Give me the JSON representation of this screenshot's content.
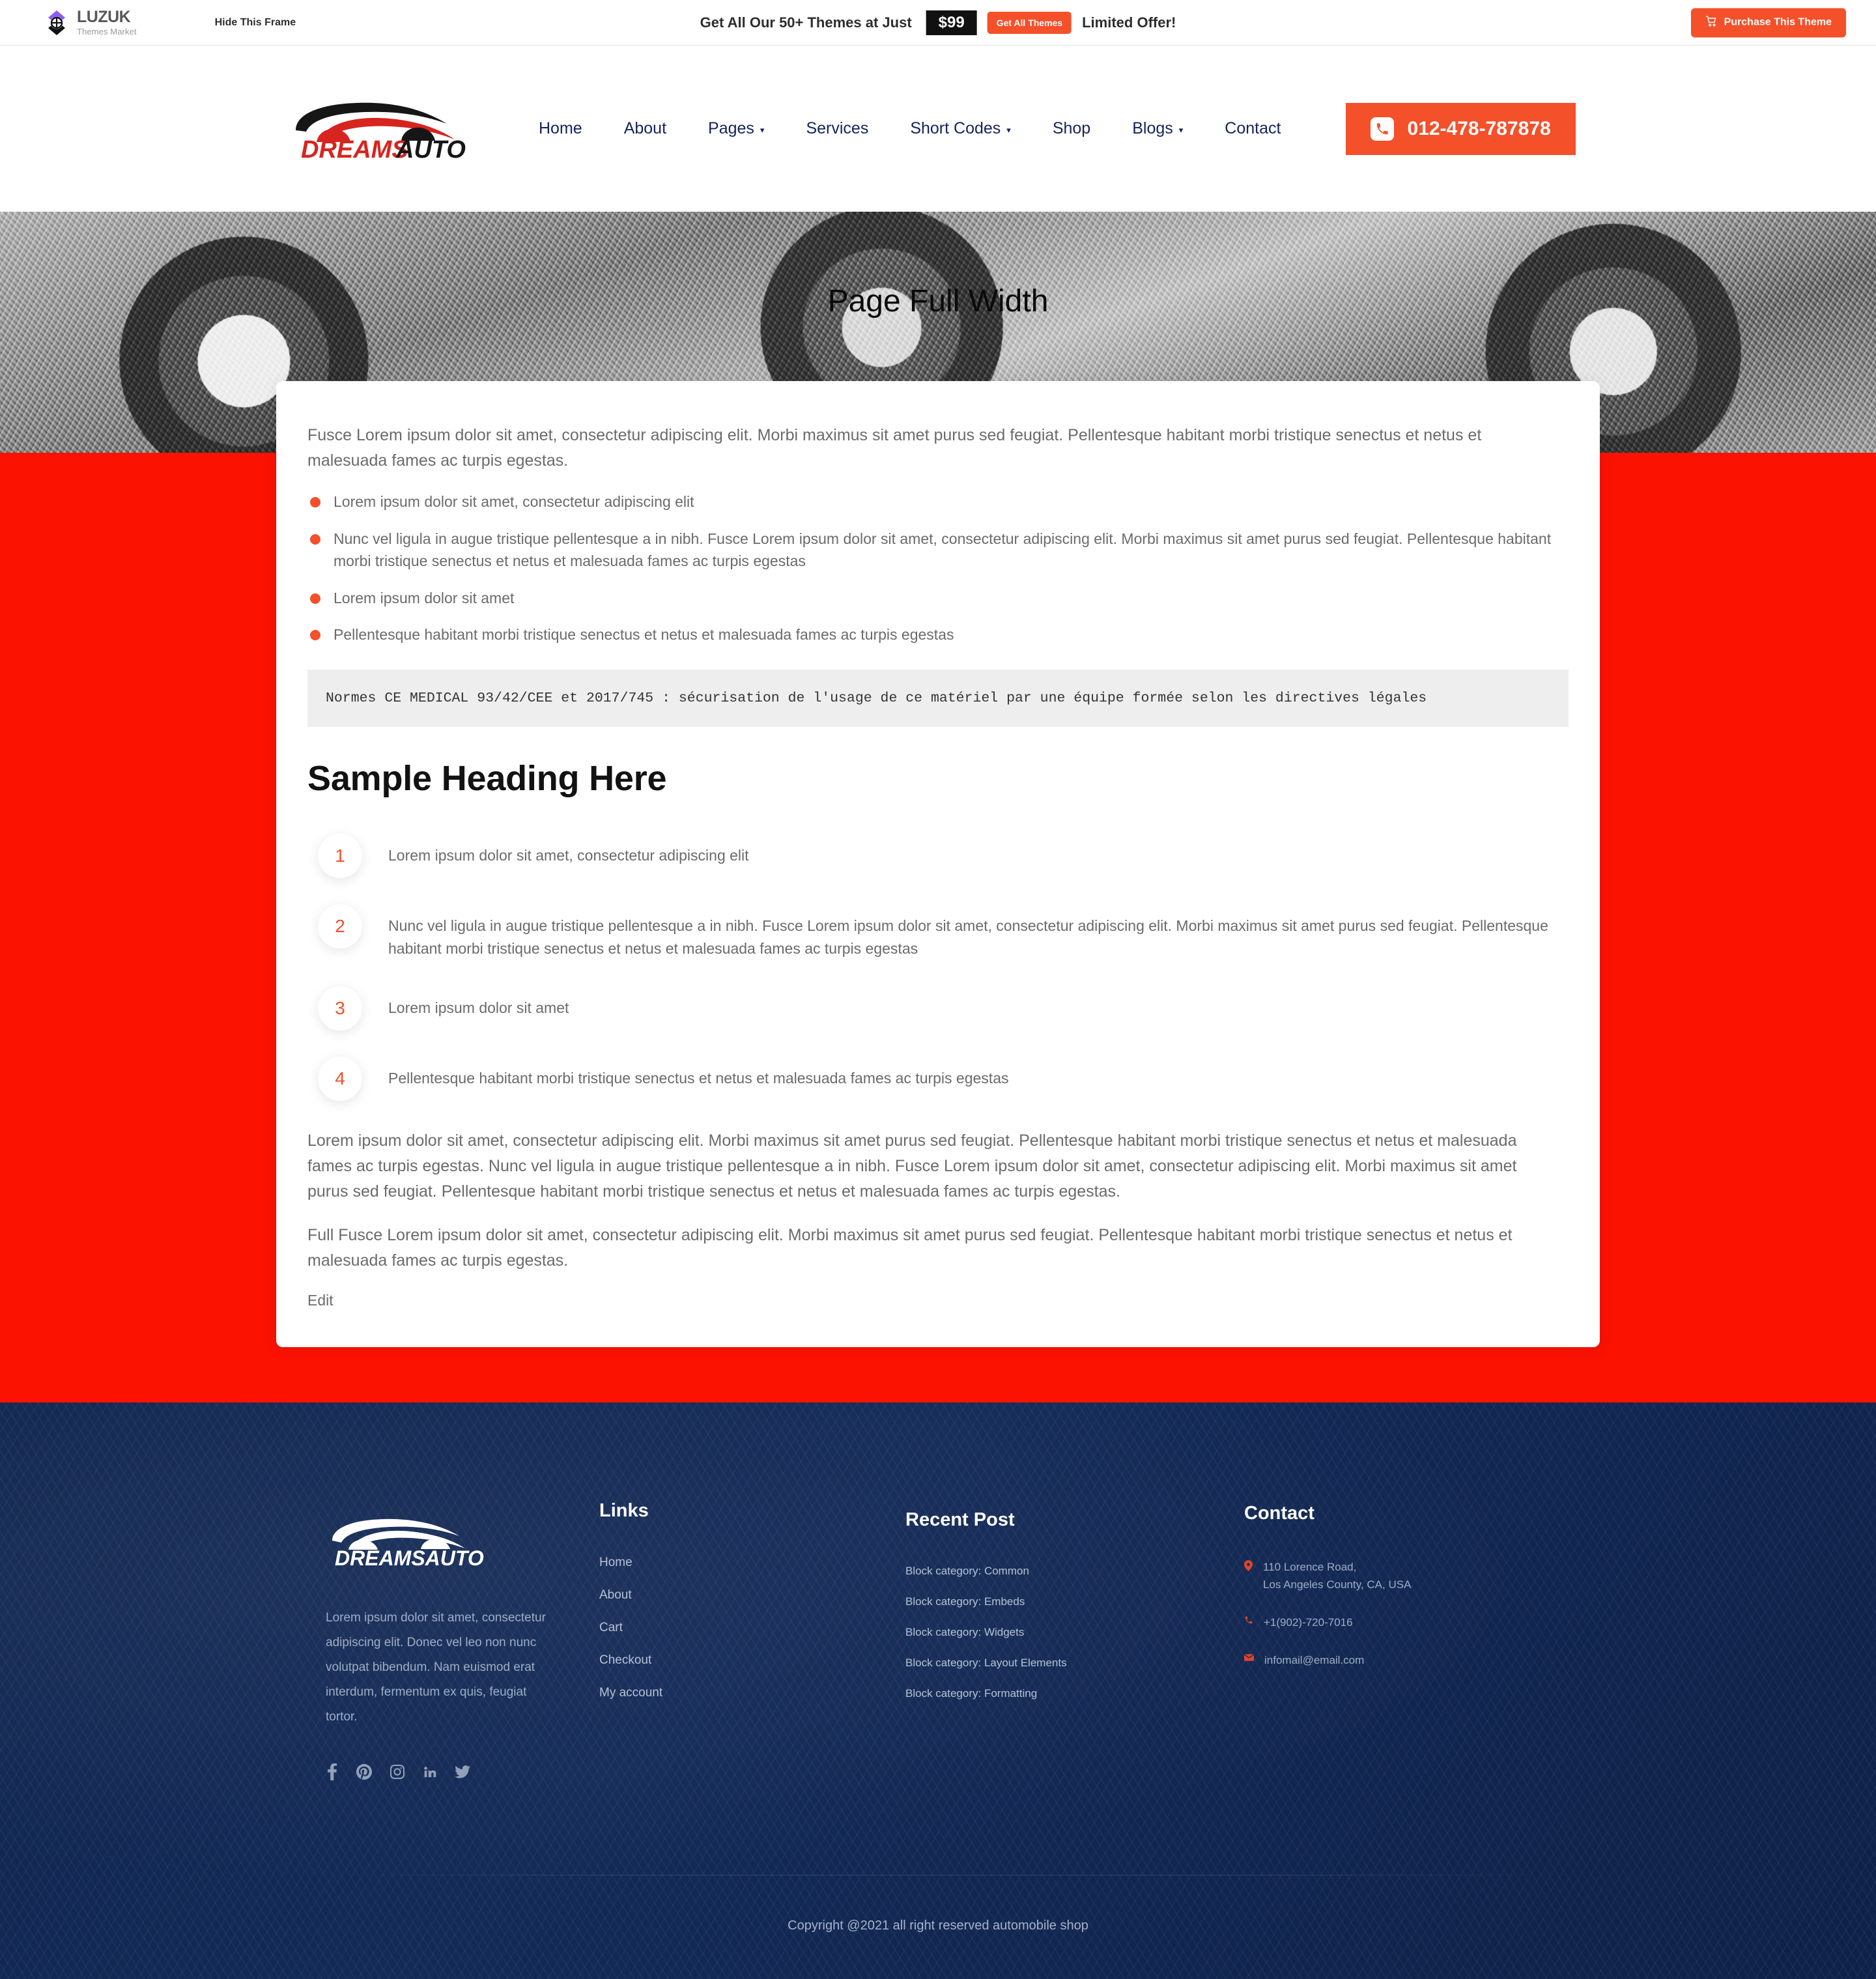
{
  "luzuk_bar": {
    "brand_name": "LUZUK",
    "brand_sub": "Themes Market",
    "hide_frame_label": "Hide This Frame",
    "promo_text": "Get All Our 50+ Themes at Just",
    "promo_price": "$99",
    "promo_button": "Get All Themes",
    "promo_limited": "Limited Offer!",
    "purchase_button": "Purchase This Theme",
    "accent_color": "#f4502a",
    "price_bg": "#111111"
  },
  "header": {
    "logo_primary": "DREAMS",
    "logo_secondary": "AUTO",
    "nav": [
      {
        "label": "Home",
        "has_caret": false
      },
      {
        "label": "About",
        "has_caret": false
      },
      {
        "label": "Pages",
        "has_caret": true
      },
      {
        "label": "Services",
        "has_caret": false
      },
      {
        "label": "Short Codes",
        "has_caret": true
      },
      {
        "label": "Shop",
        "has_caret": false
      },
      {
        "label": "Blogs",
        "has_caret": true
      },
      {
        "label": "Contact",
        "has_caret": false
      }
    ],
    "phone": "012-478-787878",
    "nav_color": "#14245a"
  },
  "hero": {
    "title": "Page Full Width"
  },
  "content": {
    "intro": "Fusce Lorem ipsum dolor sit amet, consectetur adipiscing elit. Morbi maximus sit amet purus sed feugiat. Pellentesque habitant morbi tristique senectus et netus et malesuada fames ac turpis egestas.",
    "bullets": [
      "Lorem ipsum dolor sit amet, consectetur adipiscing elit",
      "Nunc vel ligula in augue tristique pellentesque a in nibh. Fusce Lorem ipsum dolor sit amet, consectetur adipiscing elit. Morbi maximus sit amet purus sed feugiat. Pellentesque habitant morbi tristique senectus et netus et malesuada fames ac turpis egestas",
      "Lorem ipsum dolor sit amet",
      "Pellentesque habitant morbi tristique senectus et netus et malesuada fames ac turpis egestas"
    ],
    "code_block": "Normes CE MEDICAL 93/42/CEE et 2017/745 : sécurisation de l'usage de ce matériel par une équipe formée selon les directives légales",
    "heading": "Sample Heading Here",
    "numbered": [
      {
        "num": "1",
        "text": "Lorem ipsum dolor sit amet, consectetur adipiscing elit"
      },
      {
        "num": "2",
        "text": "Nunc vel ligula in augue tristique pellentesque a in nibh. Fusce Lorem ipsum dolor sit amet, consectetur adipiscing elit. Morbi maximus sit amet purus sed feugiat. Pellentesque habitant morbi tristique senectus et netus et malesuada fames ac turpis egestas"
      },
      {
        "num": "3",
        "text": "Lorem ipsum dolor sit amet"
      },
      {
        "num": "4",
        "text": "Pellentesque habitant morbi tristique senectus et netus et malesuada fames ac turpis egestas"
      }
    ],
    "paragraph_1": "Lorem ipsum dolor sit amet, consectetur adipiscing elit. Morbi maximus sit amet purus sed feugiat. Pellentesque habitant morbi tristique senectus et netus et malesuada fames ac turpis egestas. Nunc vel ligula in augue tristique pellentesque a in nibh. Fusce Lorem ipsum dolor sit amet, consectetur adipiscing elit. Morbi maximus sit amet purus sed feugiat. Pellentesque habitant morbi tristique senectus et netus et malesuada fames ac turpis egestas.",
    "paragraph_2": "Full Fusce Lorem ipsum dolor sit amet, consectetur adipiscing elit. Morbi maximus sit amet purus sed feugiat. Pellentesque habitant morbi tristique senectus et netus et malesuada fames ac turpis egestas.",
    "edit_label": "Edit",
    "section_bg": "#fb1200",
    "bullet_color": "#f4502a"
  },
  "footer": {
    "logo_text": "DREAMSAUTO",
    "about": "Lorem ipsum dolor sit amet, consectetur adipiscing elit. Donec vel leo non nunc volutpat bibendum. Nam euismod erat interdum, fermentum ex quis, feugiat tortor.",
    "socials": [
      {
        "name": "facebook-icon"
      },
      {
        "name": "pinterest-icon"
      },
      {
        "name": "instagram-icon"
      },
      {
        "name": "linkedin-icon"
      },
      {
        "name": "twitter-icon"
      }
    ],
    "links_title": "Links",
    "links": [
      "Home",
      "About",
      "Cart",
      "Checkout",
      "My account"
    ],
    "posts_title": "Recent Post",
    "posts": [
      "Block category: Common",
      "Block category: Embeds",
      "Block category: Widgets",
      "Block category: Layout Elements",
      "Block category: Formatting"
    ],
    "contact_title": "Contact",
    "address_line_1": "110 Lorence Road,",
    "address_line_2": "Los Angeles County, CA, USA",
    "phone": "+1(902)-720-7016",
    "email": "infomail@email.com",
    "copyright": "Copyright @2021 all right reserved automobile shop",
    "bg_color": "#10264f",
    "icon_color": "#e0452b"
  }
}
